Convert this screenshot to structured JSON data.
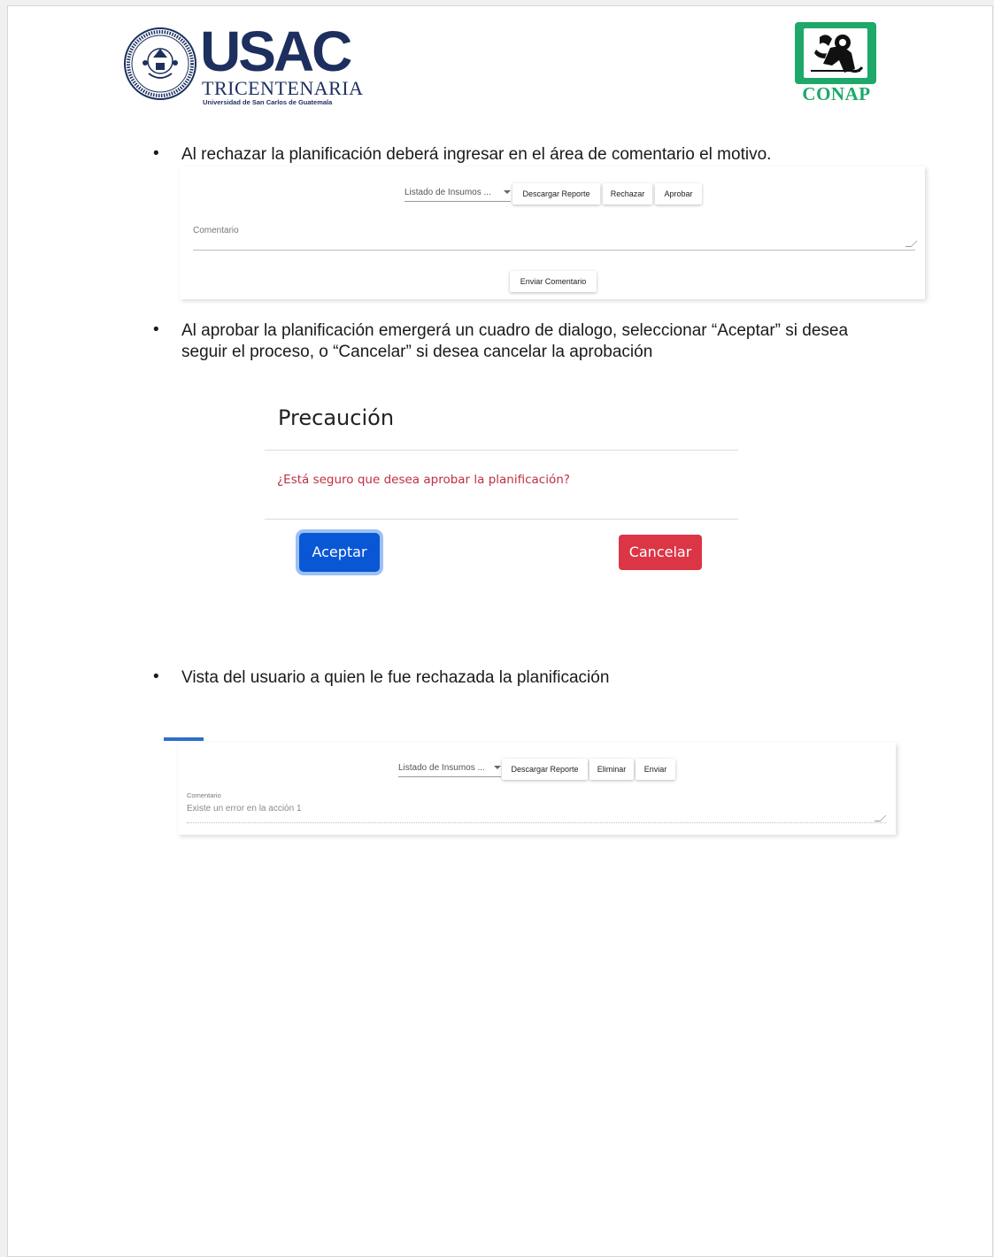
{
  "header": {
    "usac": {
      "name": "USAC",
      "subtitle": "TRICENTENARIA",
      "tagline": "Universidad de San Carlos de Guatemala",
      "seal_icon": "university-seal-icon"
    },
    "conap": {
      "name": "CONAP",
      "emblem_icon": "monkey-emblem-icon",
      "color": "#1ea86a"
    }
  },
  "sections": {
    "reject": {
      "bullet": "•",
      "text": "Al rechazar la planificación deberá ingresar en el área de comentario el motivo."
    },
    "approve": {
      "bullet": "•",
      "line1": "Al aprobar la planificación emergerá un cuadro de dialogo, seleccionar “Aceptar” si desea",
      "line2": "seguir el proceso, o “Cancelar” si desea cancelar la aprobación"
    },
    "rejected_view": {
      "bullet": "•",
      "text": "Vista del usuario a quien le fue rechazada la planificación"
    }
  },
  "panel1": {
    "select_label": "Listado de Insumos ...",
    "buttons": {
      "download": "Descargar Reporte",
      "reject": "Rechazar",
      "approve": "Aprobar"
    },
    "comment_label": "Comentario",
    "send_button": "Enviar Comentario"
  },
  "dialog": {
    "title": "Precaución",
    "message": "¿Está seguro que desea aprobar la planificación?",
    "accept": "Aceptar",
    "cancel": "Cancelar",
    "accept_color": "#0a57d6",
    "cancel_color": "#dc3545",
    "message_color": "#c0303f"
  },
  "panel2": {
    "select_label": "Listado de Insumos ...",
    "buttons": {
      "download": "Descargar Reporte",
      "delete": "Eliminar",
      "send": "Enviar"
    },
    "comment_label": "Comentario",
    "comment_value": "Existe un error en la acción 1"
  }
}
